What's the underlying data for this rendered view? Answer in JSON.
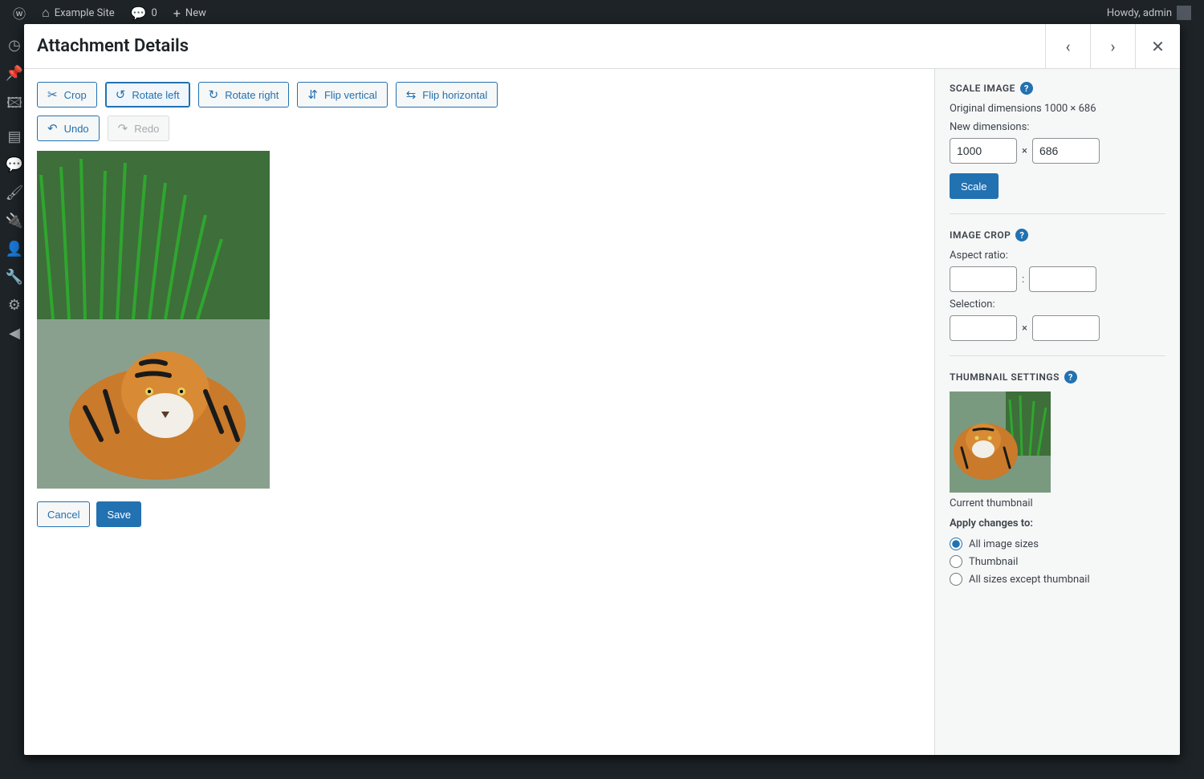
{
  "adminBar": {
    "siteName": "Example Site",
    "commentsCount": "0",
    "newLabel": "New",
    "howdy": "Howdy, admin"
  },
  "modal": {
    "title": "Attachment Details"
  },
  "toolbar": {
    "crop": "Crop",
    "rotateLeft": "Rotate left",
    "rotateRight": "Rotate right",
    "flipVertical": "Flip vertical",
    "flipHorizontal": "Flip horizontal",
    "undo": "Undo",
    "redo": "Redo"
  },
  "footer": {
    "cancel": "Cancel",
    "save": "Save"
  },
  "scale": {
    "title": "SCALE IMAGE",
    "origLabel": "Original dimensions 1000 × 686",
    "newLabel": "New dimensions:",
    "width": "1000",
    "height": "686",
    "sep": "×",
    "button": "Scale"
  },
  "crop": {
    "title": "IMAGE CROP",
    "aspectLabel": "Aspect ratio:",
    "aspectSep": ":",
    "aspectW": "",
    "aspectH": "",
    "selectionLabel": "Selection:",
    "selSep": "×",
    "selW": "",
    "selH": ""
  },
  "thumb": {
    "title": "THUMBNAIL SETTINGS",
    "caption": "Current thumbnail",
    "applyLabel": "Apply changes to:",
    "options": {
      "all": "All image sizes",
      "thumbnail": "Thumbnail",
      "nothumb": "All sizes except thumbnail"
    },
    "selected": "all"
  }
}
